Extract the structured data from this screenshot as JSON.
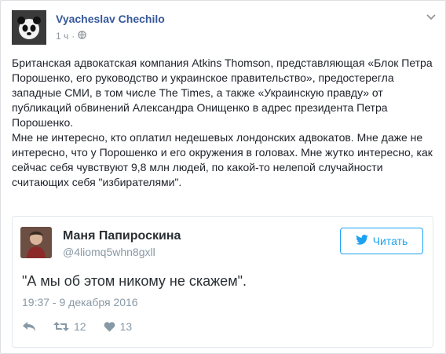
{
  "post": {
    "author": "Vyacheslav Chechilo",
    "time": "1 ч",
    "audience_icon": "globe-icon",
    "menu_icon": "chevron-down-icon",
    "paragraphs": [
      "Британская адвокатская компания Atkins Thomson, представляющая «Блок Петра Порошенко, его руководство и украинское правительство», предостерегла западные СМИ, в том числе The Times, а также «Украинскую правду» от публикаций обвинений Александра Онищенко в адрес президента Петра Порошенко.",
      "Мне не интересно, кто оплатил недешевых лондонских адвокатов. Мне даже не интересно, что у Порошенко и его окружения в головах. Мне жутко интересно, как сейчас себя чувствуют 9,8 млн людей, по какой-то нелепой случайности считающих себя \"избирателями\"."
    ]
  },
  "tweet": {
    "name": "Маня Папироскина",
    "handle": "@4liomq5whn8gxll",
    "follow_label": "Читать",
    "text": "\"А мы об этом никому не скажем\".",
    "date": "19:37 - 9 декабря 2016",
    "retweets": "12",
    "likes": "13",
    "brand_color": "#1da1f2"
  }
}
